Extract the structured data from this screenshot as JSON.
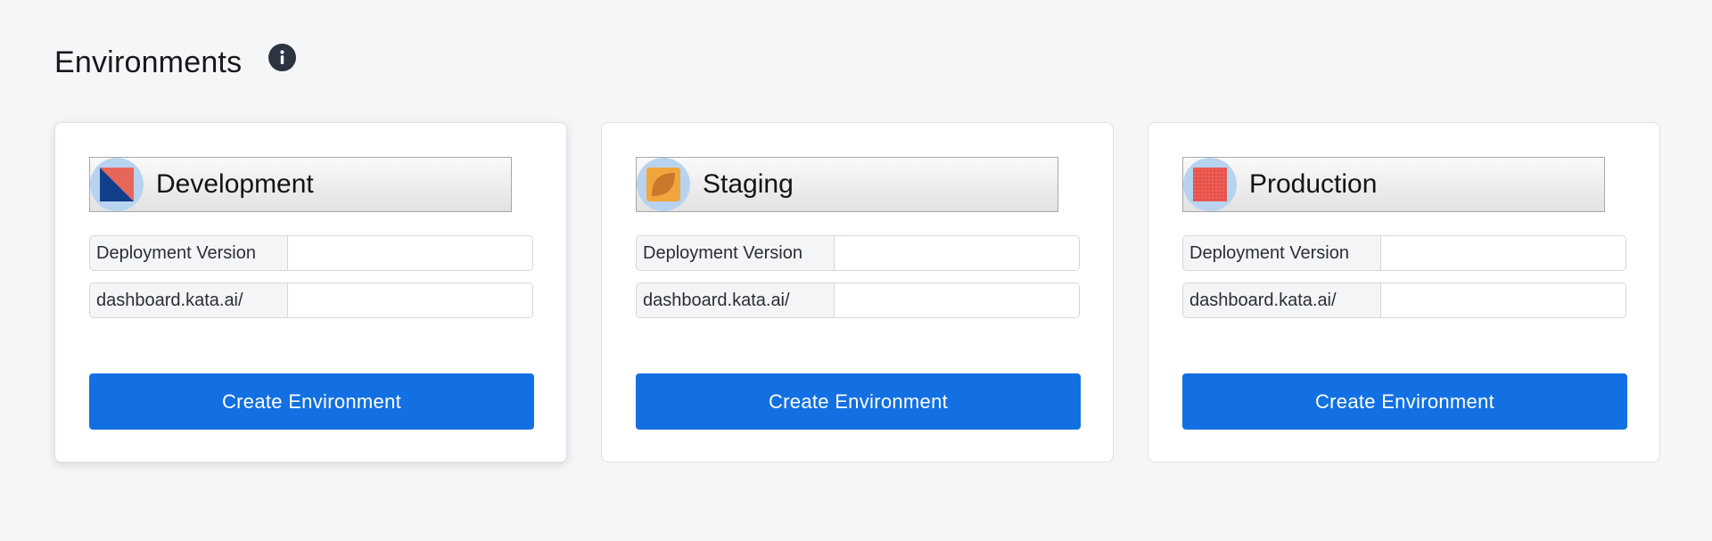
{
  "page": {
    "title": "Environments",
    "info_icon": "info-icon"
  },
  "environments": [
    {
      "name": "Development",
      "avatar_icon": "development-logo-icon",
      "fields": [
        {
          "label": "Deployment Version",
          "value": ""
        },
        {
          "label": "dashboard.kata.ai/",
          "value": ""
        }
      ],
      "button_label": "Create Environment",
      "selected": true
    },
    {
      "name": "Staging",
      "avatar_icon": "staging-logo-icon",
      "fields": [
        {
          "label": "Deployment Version",
          "value": ""
        },
        {
          "label": "dashboard.kata.ai/",
          "value": ""
        }
      ],
      "button_label": "Create Environment",
      "selected": false
    },
    {
      "name": "Production",
      "avatar_icon": "production-logo-icon",
      "fields": [
        {
          "label": "Deployment Version",
          "value": ""
        },
        {
          "label": "dashboard.kata.ai/",
          "value": ""
        }
      ],
      "button_label": "Create Environment",
      "selected": false
    }
  ],
  "colors": {
    "primary_button": "#1270e3",
    "avatar_ring": "#b8d3f0",
    "background": "#f5f6f7"
  }
}
